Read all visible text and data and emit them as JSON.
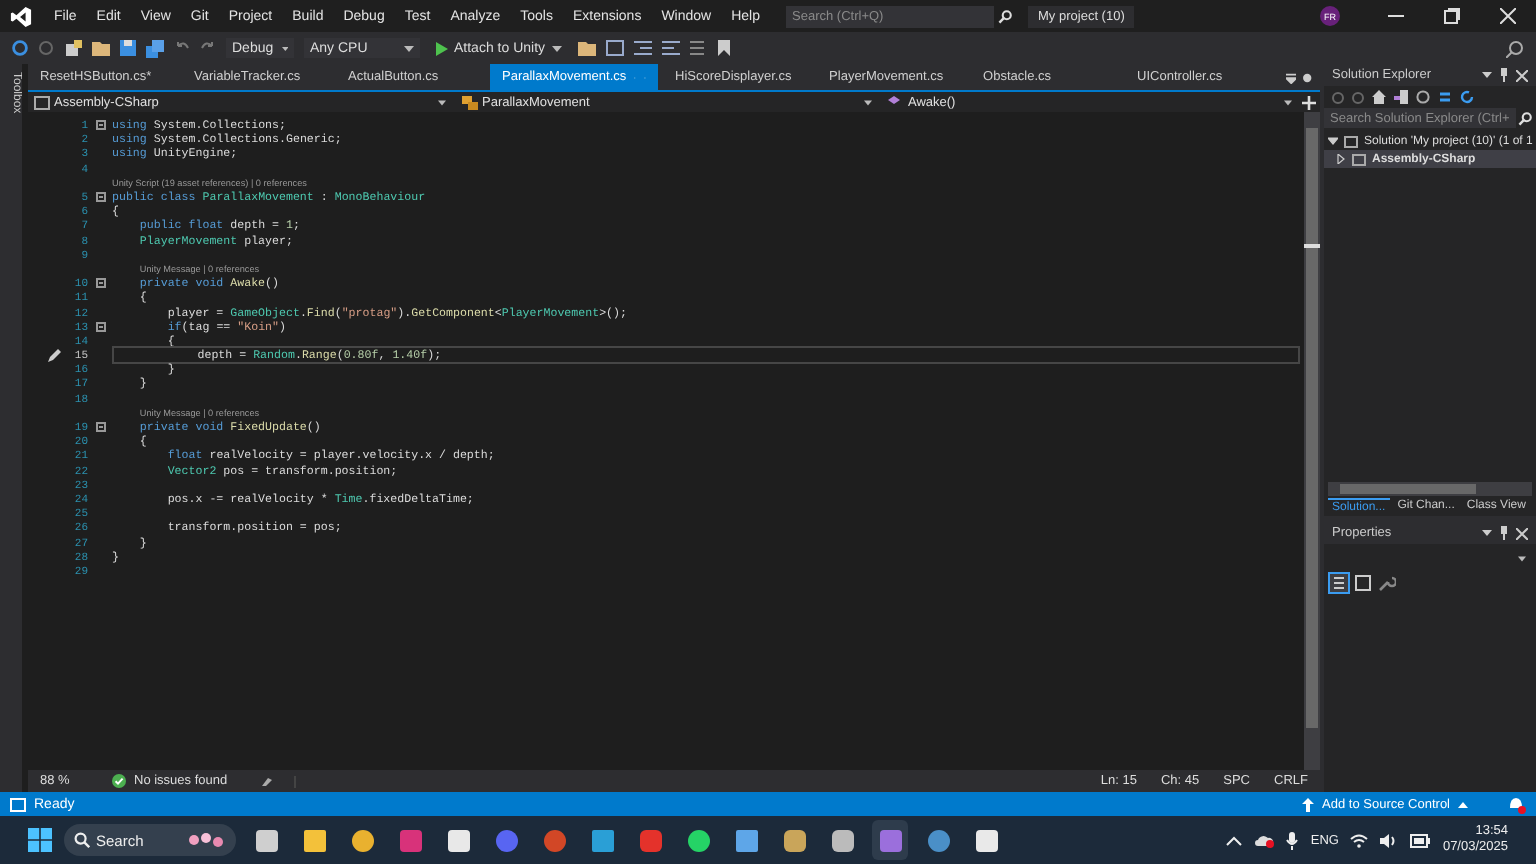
{
  "window": {
    "title": "My project (10)",
    "search": {
      "placeholder": "Search (Ctrl+Q)"
    },
    "avatar": "FR"
  },
  "menu": [
    "File",
    "Edit",
    "View",
    "Git",
    "Project",
    "Build",
    "Debug",
    "Test",
    "Analyze",
    "Tools",
    "Extensions",
    "Window",
    "Help"
  ],
  "toolbar": {
    "configuration": "Debug",
    "platform": "Any CPU",
    "run": "Attach to Unity"
  },
  "toolbox": {
    "label": "Toolbox"
  },
  "tabs": [
    {
      "label": "ResetHSButton.cs*",
      "selected": false
    },
    {
      "label": "VariableTracker.cs",
      "selected": false
    },
    {
      "label": "ActualButton.cs",
      "selected": false
    },
    {
      "label": "ParallaxMovement.cs",
      "selected": true
    },
    {
      "label": "HiScoreDisplayer.cs",
      "selected": false
    },
    {
      "label": "PlayerMovement.cs",
      "selected": false
    },
    {
      "label": "Obstacle.cs",
      "selected": false
    },
    {
      "label": "UIController.cs",
      "selected": false
    }
  ],
  "navigation": {
    "project": "Assembly-CSharp",
    "type": "ParallaxMovement",
    "member": "Awake()"
  },
  "code": [
    {
      "kind": "code",
      "n": "1",
      "fold": true,
      "current": false,
      "tokens": [
        {
          "kind": "kw",
          "text": "using"
        },
        {
          "kind": "plain",
          "text": " System.Collections;"
        }
      ]
    },
    {
      "kind": "code",
      "n": "2",
      "fold": false,
      "current": false,
      "tokens": [
        {
          "kind": "kw",
          "text": "using"
        },
        {
          "kind": "plain",
          "text": " System.Collections.Generic;"
        }
      ]
    },
    {
      "kind": "code",
      "n": "3",
      "fold": false,
      "current": false,
      "tokens": [
        {
          "kind": "kw",
          "text": "using"
        },
        {
          "kind": "plain",
          "text": " UnityEngine;"
        }
      ]
    },
    {
      "kind": "code",
      "n": "4",
      "fold": false,
      "current": false
    },
    {
      "kind": "lens",
      "text": "Unity Script (19 asset references) | 0 references"
    },
    {
      "kind": "code",
      "n": "5",
      "fold": true,
      "current": false,
      "tokens": [
        {
          "kind": "kw",
          "text": "public class "
        },
        {
          "kind": "type",
          "text": "ParallaxMovement"
        },
        {
          "kind": "plain",
          "text": " : "
        },
        {
          "kind": "type",
          "text": "MonoBehaviour"
        }
      ]
    },
    {
      "kind": "code",
      "n": "6",
      "fold": false,
      "current": false,
      "tokens": [
        {
          "kind": "plain",
          "text": "{"
        }
      ]
    },
    {
      "kind": "code",
      "n": "7",
      "fold": false,
      "current": false,
      "tokens": [
        {
          "kind": "kw",
          "text": "    public float"
        },
        {
          "kind": "plain",
          "text": " depth = "
        },
        {
          "kind": "num",
          "text": "1"
        },
        {
          "kind": "plain",
          "text": ";"
        }
      ]
    },
    {
      "kind": "code",
      "n": "8",
      "fold": false,
      "current": false,
      "tokens": [
        {
          "kind": "type",
          "text": "    PlayerMovement"
        },
        {
          "kind": "plain",
          "text": " player;"
        }
      ]
    },
    {
      "kind": "code",
      "n": "9",
      "fold": false,
      "current": false
    },
    {
      "kind": "lens",
      "text": "Unity Message | 0 references"
    },
    {
      "kind": "code",
      "n": "10",
      "fold": true,
      "current": false,
      "tokens": [
        {
          "kind": "kw",
          "text": "    private void "
        },
        {
          "kind": "method",
          "text": "Awake"
        },
        {
          "kind": "plain",
          "text": "()"
        }
      ]
    },
    {
      "kind": "code",
      "n": "11",
      "fold": false,
      "current": false,
      "tokens": [
        {
          "kind": "plain",
          "text": "    {"
        }
      ]
    },
    {
      "kind": "code",
      "n": "12",
      "fold": false,
      "current": false,
      "tokens": [
        {
          "kind": "plain",
          "text": "        player = "
        },
        {
          "kind": "type",
          "text": "GameObject"
        },
        {
          "kind": "plain",
          "text": "."
        },
        {
          "kind": "method",
          "text": "Find"
        },
        {
          "kind": "plain",
          "text": "("
        },
        {
          "kind": "str",
          "text": "\"protag\""
        },
        {
          "kind": "plain",
          "text": ")."
        },
        {
          "kind": "method",
          "text": "GetComponent"
        },
        {
          "kind": "plain",
          "text": "<"
        },
        {
          "kind": "type",
          "text": "PlayerMovement"
        },
        {
          "kind": "plain",
          "text": ">();"
        }
      ]
    },
    {
      "kind": "code",
      "n": "13",
      "fold": true,
      "current": false,
      "tokens": [
        {
          "kind": "kw",
          "text": "        if"
        },
        {
          "kind": "plain",
          "text": "(tag == "
        },
        {
          "kind": "str",
          "text": "\"Koin\""
        },
        {
          "kind": "plain",
          "text": ")"
        }
      ]
    },
    {
      "kind": "code",
      "n": "14",
      "fold": false,
      "current": false,
      "tokens": [
        {
          "kind": "plain",
          "text": "        {"
        }
      ]
    },
    {
      "kind": "code",
      "n": "15",
      "fold": false,
      "current": true,
      "tokens": [
        {
          "kind": "plain",
          "text": "            depth = "
        },
        {
          "kind": "type",
          "text": "Random"
        },
        {
          "kind": "plain",
          "text": "."
        },
        {
          "kind": "method",
          "text": "Range"
        },
        {
          "kind": "plain",
          "text": "("
        },
        {
          "kind": "num",
          "text": "0.80f"
        },
        {
          "kind": "plain",
          "text": ", "
        },
        {
          "kind": "num",
          "text": "1.40f"
        },
        {
          "kind": "plain",
          "text": ");"
        }
      ]
    },
    {
      "kind": "code",
      "n": "16",
      "fold": false,
      "current": false,
      "tokens": [
        {
          "kind": "plain",
          "text": "        }"
        }
      ]
    },
    {
      "kind": "code",
      "n": "17",
      "fold": false,
      "current": false,
      "tokens": [
        {
          "kind": "plain",
          "text": "    }"
        }
      ]
    },
    {
      "kind": "code",
      "n": "18",
      "fold": false,
      "current": false
    },
    {
      "kind": "lens",
      "text": "Unity Message | 0 references"
    },
    {
      "kind": "code",
      "n": "19",
      "fold": true,
      "current": false,
      "tokens": [
        {
          "kind": "kw",
          "text": "    private void "
        },
        {
          "kind": "method",
          "text": "FixedUpdate"
        },
        {
          "kind": "plain",
          "text": "()"
        }
      ]
    },
    {
      "kind": "code",
      "n": "20",
      "fold": false,
      "current": false,
      "tokens": [
        {
          "kind": "plain",
          "text": "    {"
        }
      ]
    },
    {
      "kind": "code",
      "n": "21",
      "fold": false,
      "current": false,
      "tokens": [
        {
          "kind": "kw",
          "text": "        float"
        },
        {
          "kind": "plain",
          "text": " realVelocity = player.velocity.x / depth;"
        }
      ]
    },
    {
      "kind": "code",
      "n": "22",
      "fold": false,
      "current": false,
      "tokens": [
        {
          "kind": "type",
          "text": "        Vector2"
        },
        {
          "kind": "plain",
          "text": " pos = transform.position;"
        }
      ]
    },
    {
      "kind": "code",
      "n": "23",
      "fold": false,
      "current": false
    },
    {
      "kind": "code",
      "n": "24",
      "fold": false,
      "current": false,
      "tokens": [
        {
          "kind": "plain",
          "text": "        pos.x -= realVelocity * "
        },
        {
          "kind": "type",
          "text": "Time"
        },
        {
          "kind": "plain",
          "text": ".fixedDeltaTime;"
        }
      ]
    },
    {
      "kind": "code",
      "n": "25",
      "fold": false,
      "current": false
    },
    {
      "kind": "code",
      "n": "26",
      "fold": false,
      "current": false,
      "tokens": [
        {
          "kind": "plain",
          "text": "        transform.position = pos;"
        }
      ]
    },
    {
      "kind": "code",
      "n": "27",
      "fold": false,
      "current": false,
      "tokens": [
        {
          "kind": "plain",
          "text": "    }"
        }
      ]
    },
    {
      "kind": "code",
      "n": "28",
      "fold": false,
      "current": false,
      "tokens": [
        {
          "kind": "plain",
          "text": "}"
        }
      ]
    },
    {
      "kind": "code",
      "n": "29",
      "fold": false,
      "current": false
    }
  ],
  "editor_status": {
    "zoom": "88 %",
    "issues": "No issues found",
    "line": "Ln: 15",
    "column": "Ch: 45",
    "whitespace": "SPC",
    "line_ending": "CRLF"
  },
  "solution_explorer": {
    "title": "Solution Explorer",
    "search": {
      "placeholder": "Search Solution Explorer (Ctrl+"
    },
    "tree": [
      {
        "label": "Solution 'My project (10)' (1 of 1",
        "expanded": true,
        "children": [
          {
            "label": "Assembly-CSharp",
            "expanded": false
          }
        ]
      }
    ],
    "tabs": [
      {
        "label": "Solution...",
        "selected": true
      },
      {
        "label": "Git Chan...",
        "selected": false
      },
      {
        "label": "Class View",
        "selected": false
      }
    ]
  },
  "properties": {
    "title": "Properties"
  },
  "status_bar": {
    "state": "Ready",
    "source_control": "Add to Source Control"
  },
  "taskbar": {
    "search": {
      "placeholder": "Search"
    },
    "language": "ENG",
    "time": "13:54",
    "date": "07/03/2025"
  }
}
